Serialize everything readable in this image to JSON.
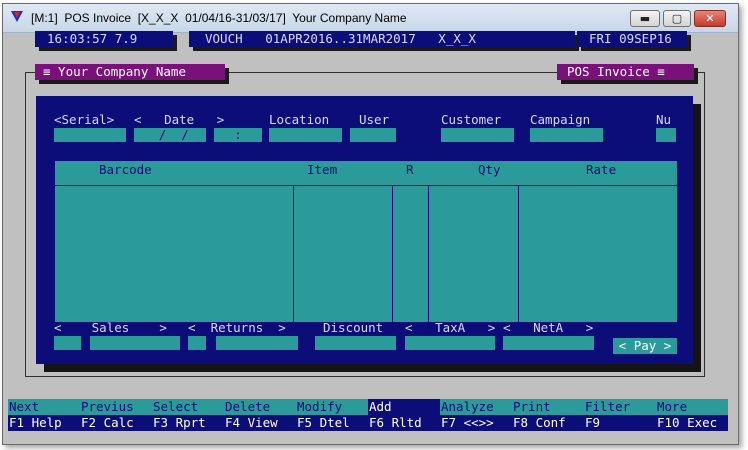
{
  "window": {
    "title": "[M:1]  POS Invoice  [X_X_X  01/04/16-31/03/17]  Your Company Name",
    "min_label": "▬",
    "max_label": "▢",
    "close_label": "✕"
  },
  "status": {
    "clock": "16:03:57 7.9",
    "voucher": "VOUCH   01APR2016..31MAR2017   X_X_X",
    "day_date": "FRI 09SEP16"
  },
  "header": {
    "company_menu": "≡ Your Company Name",
    "screen_title": "POS Invoice ≡"
  },
  "form": {
    "serial_label": "<Serial>",
    "date_label": "<   Date   >",
    "location_label": "Location",
    "user_label": "User",
    "customer_label": "Customer",
    "campaign_label": "Campaign",
    "number_label": "Nu",
    "date_value": " /  /",
    "time_value": ":",
    "serial_value": "",
    "location_value": "",
    "user_value": "",
    "customer_value": "",
    "campaign_value": "",
    "number_value": ""
  },
  "grid": {
    "columns": [
      "Barcode",
      "Item",
      "R",
      "Qty",
      "Rate"
    ],
    "rows": []
  },
  "totals": {
    "sales_label": "<    Sales    >",
    "returns_label": "<  Returns  >",
    "discount_label": "Discount",
    "taxa_label": "<   TaxA   >",
    "neta_label": "<   NetA   >",
    "pay_label": "< Pay >"
  },
  "fkeys": [
    {
      "top": "Next",
      "bottom": "F1 Help"
    },
    {
      "top": "Previus",
      "bottom": "F2 Calc"
    },
    {
      "top": "Select",
      "bottom": "F3 Rprt"
    },
    {
      "top": "Delete",
      "bottom": "F4 View"
    },
    {
      "top": "Modify",
      "bottom": "F5 Dtel"
    },
    {
      "top": "Add",
      "bottom": "F6 Rltd"
    },
    {
      "top": "Analyze",
      "bottom": "F7 <<>>"
    },
    {
      "top": "Print",
      "bottom": "F8 Conf"
    },
    {
      "top": "Filter",
      "bottom": "F9"
    },
    {
      "top": "More",
      "bottom": "F10 Exec"
    }
  ],
  "colors": {
    "dark_blue": "#0d0d7a",
    "teal": "#2a9a9a",
    "magenta": "#7a107a",
    "gray": "#c0c0c0"
  }
}
